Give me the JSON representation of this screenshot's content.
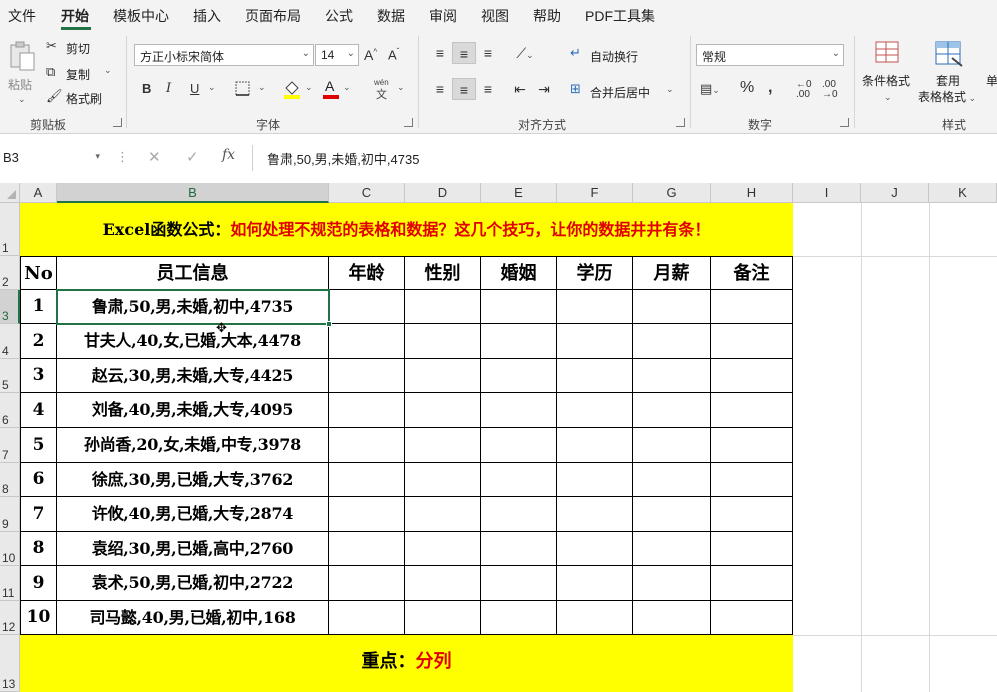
{
  "menu": {
    "items": [
      "文件",
      "开始",
      "模板中心",
      "插入",
      "页面布局",
      "公式",
      "数据",
      "审阅",
      "视图",
      "帮助",
      "PDF工具集"
    ],
    "active_index": 1
  },
  "ribbon": {
    "clipboard": {
      "paste": "粘贴",
      "cut": "剪切",
      "copy": "复制",
      "format_painter": "格式刷",
      "group_label": "剪贴板"
    },
    "font": {
      "font_name": "方正小标宋简体",
      "font_size": "14",
      "bold": "B",
      "italic": "I",
      "underline": "U",
      "phonetic": "wén",
      "group_label": "字体"
    },
    "alignment": {
      "wrap_text": "自动换行",
      "merge_center": "合并后居中",
      "group_label": "对齐方式"
    },
    "number": {
      "format": "常规",
      "group_label": "数字"
    },
    "styles": {
      "conditional_format": "条件格式",
      "table_format_top": "套用",
      "table_format_bottom": "表格格式",
      "cell_styles": "单",
      "group_label": "样式"
    }
  },
  "formula_bar": {
    "name_box": "B3",
    "formula": "鲁肃,50,男,未婚,初中,4735"
  },
  "columns": [
    "A",
    "B",
    "C",
    "D",
    "E",
    "F",
    "G",
    "H",
    "I",
    "J",
    "K"
  ],
  "rows": [
    "1",
    "2",
    "3",
    "4",
    "5",
    "6",
    "7",
    "8",
    "9",
    "10",
    "11",
    "12",
    "13"
  ],
  "sheet": {
    "title": {
      "prefix": "Excel函数公式：",
      "text": "如何处理不规范的表格和数据？这几个技巧，让你的数据井井有条！"
    },
    "headers": [
      "No",
      "员工信息",
      "年龄",
      "性别",
      "婚姻",
      "学历",
      "月薪",
      "备注"
    ],
    "records": [
      {
        "no": "1",
        "info": "鲁肃,50,男,未婚,初中,4735"
      },
      {
        "no": "2",
        "info": "甘夫人,40,女,已婚,大本,4478"
      },
      {
        "no": "3",
        "info": "赵云,30,男,未婚,大专,4425"
      },
      {
        "no": "4",
        "info": "刘备,40,男,未婚,大专,4095"
      },
      {
        "no": "5",
        "info": "孙尚香,20,女,未婚,中专,3978"
      },
      {
        "no": "6",
        "info": "徐庶,30,男,已婚,大专,3762"
      },
      {
        "no": "7",
        "info": "许攸,40,男,已婚,大专,2874"
      },
      {
        "no": "8",
        "info": "袁绍,30,男,已婚,高中,2760"
      },
      {
        "no": "9",
        "info": "袁术,50,男,已婚,初中,2722"
      },
      {
        "no": "10",
        "info": "司马懿,40,男,已婚,初中,168"
      }
    ],
    "footer": {
      "prefix": "重点：",
      "text": "分列"
    }
  },
  "colors": {
    "excel_green": "#217346",
    "banner_yellow": "#ffff00",
    "accent_red": "#e00000"
  }
}
